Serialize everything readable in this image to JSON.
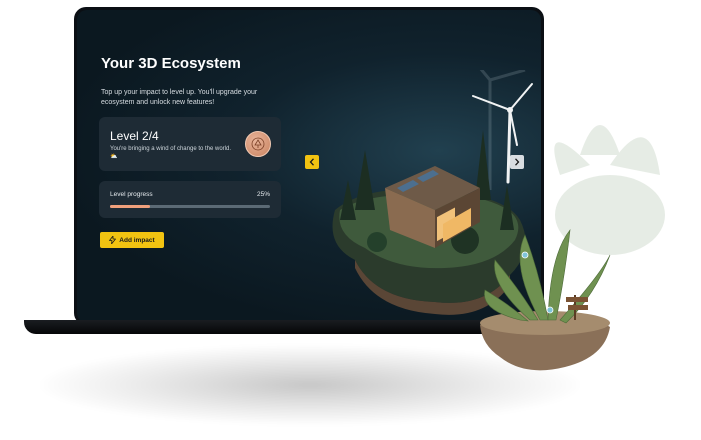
{
  "panel": {
    "title": "Your 3D Ecosystem",
    "subtitle": "Top up your impact to level up. You'll upgrade your ecosystem and unlock new features!"
  },
  "level_card": {
    "title": "Level 2/4",
    "description": "You're bringing a wind of change to the world. ⛅",
    "badge_icon": "tree-badge-icon"
  },
  "progress": {
    "label": "Level progress",
    "value_text": "25%",
    "value": 0.25
  },
  "actions": {
    "add_impact_label": "Add impact",
    "add_impact_icon": "lightning-icon"
  },
  "carousel": {
    "prev_icon": "chevron-left-icon",
    "next_icon": "chevron-right-icon"
  },
  "colors": {
    "accent": "#f2c311",
    "progress_fill": "#f0a07c",
    "card_bg": "#1e2b35"
  }
}
